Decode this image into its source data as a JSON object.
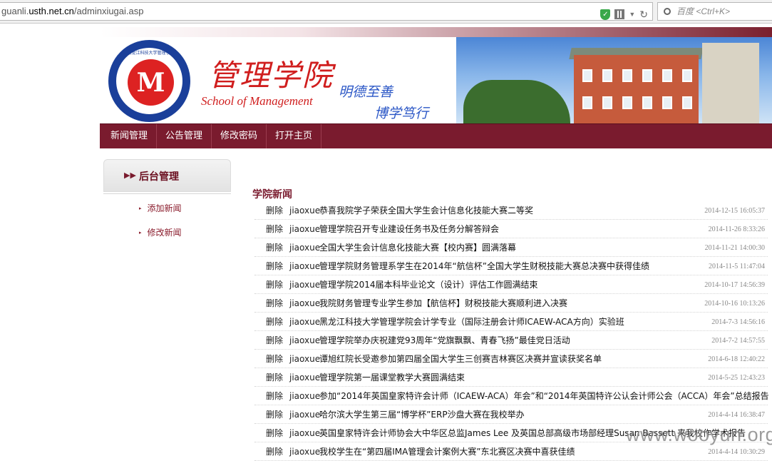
{
  "browser": {
    "url_prefix": "guanli.",
    "url_domain": "usth.net.cn",
    "url_path": "/adminxiugai.asp",
    "search_placeholder": "百度 <Ctrl+K>"
  },
  "banner": {
    "title_cn": "管理学院",
    "title_en": "School of Management",
    "motto_1": "明德至善",
    "motto_2": "博学笃行",
    "logo_letter": "M",
    "logo_ring_text": "黑龙江科技大学管理学院"
  },
  "nav": {
    "items": [
      "新闻管理",
      "公告管理",
      "修改密码",
      "打开主页"
    ]
  },
  "sidebar": {
    "title": "后台管理",
    "items": [
      "添加新闻",
      "修改新闻"
    ]
  },
  "news": {
    "title": "学院新闻",
    "delete_label": "删除",
    "rows": [
      {
        "user": "jiaoxue",
        "title": "恭喜我院学子荣获全国大学生会计信息化技能大赛二等奖",
        "date": "2014-12-15 16:05:37"
      },
      {
        "user": "jiaoxue",
        "title": "管理学院召开专业建设任务书及任务分解答辩会",
        "date": "2014-11-26 8:33:26"
      },
      {
        "user": "jiaoxue",
        "title": "全国大学生会计信息化技能大赛【校内赛】圆满落幕",
        "date": "2014-11-21 14:00:30"
      },
      {
        "user": "jiaoxue",
        "title": "管理学院财务管理系学生在2014年“航信杯”全国大学生财税技能大赛总决赛中获得佳绩",
        "date": "2014-11-5 11:47:04"
      },
      {
        "user": "jiaoxue",
        "title": " 管理学院2014届本科毕业论文（设计）评估工作圆满结束",
        "date": "2014-10-17 14:56:39"
      },
      {
        "user": "jiaoxue",
        "title": "我院财务管理专业学生参加【航信杯】财税技能大赛顺利进入决赛",
        "date": "2014-10-16 10:13:26"
      },
      {
        "user": "jiaoxue",
        "title": "黑龙江科技大学管理学院会计学专业（国际注册会计师ICAEW-ACA方向）实验班",
        "date": "2014-7-3 14:56:16"
      },
      {
        "user": "jiaoxue",
        "title": "管理学院举办庆祝建党93周年“党旗飘飘、青春飞扬”最佳党日活动",
        "date": "2014-7-2 14:57:55"
      },
      {
        "user": "jiaoxue",
        "title": "谭旭红院长受邀参加第四届全国大学生三创赛吉林赛区决赛并宣读获奖名单",
        "date": "2014-6-18 12:40:22"
      },
      {
        "user": "jiaoxue",
        "title": "管理学院第一届课堂教学大赛圆满结束",
        "date": "2014-5-25 12:43:23"
      },
      {
        "user": "jiaoxue",
        "title": "参加“2014年英国皇家特许会计师（ICAEW-ACA）年会”和“2014年英国特许公认会计师公会（ACCA）年会”总结报告",
        "date": ""
      },
      {
        "user": "jiaoxue",
        "title": "哈尔滨大学生第三届“博学杯”ERP沙盘大赛在我校举办",
        "date": "2014-4-14 16:38:47"
      },
      {
        "user": "jiaoxue",
        "title": "英国皇家特许会计师协会大中华区总监James Lee 及英国总部高级市场部经理Susan Bassett 来我校作学术报告",
        "date": ""
      },
      {
        "user": "jiaoxue",
        "title": "我校学生在“第四届IMA管理会计案例大赛”东北赛区决赛中喜获佳绩",
        "date": "2014-4-14 10:30:29"
      }
    ]
  },
  "watermark": "www.wooyun.org"
}
